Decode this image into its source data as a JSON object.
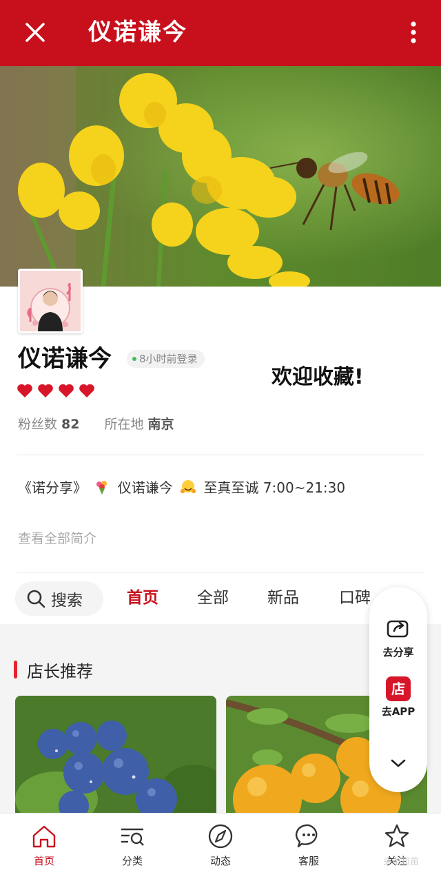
{
  "topbar": {
    "title": "仪诺谦今",
    "bg_color": "#c8101c"
  },
  "shop": {
    "name": "仪诺谦今",
    "login_status": "8小时前登录",
    "welcome": "欢迎收藏!",
    "rating_hearts": 4,
    "fans_label": "粉丝数",
    "fans_count": "82",
    "location_label": "所在地",
    "location": "南京",
    "intro_part1": "《诺分享》",
    "intro_part2": "仪诺谦今",
    "intro_part3": "至真至诚 7:00~21:30",
    "view_all": "查看全部简介"
  },
  "nav": {
    "search_label": "搜索",
    "tabs": [
      "首页",
      "全部",
      "新品",
      "口碑"
    ],
    "active_tab": "首页"
  },
  "section": {
    "title": "店长推荐",
    "accent_color": "#e5242b"
  },
  "float_panel": {
    "share_label": "去分享",
    "app_label": "去APP",
    "app_badge": "店"
  },
  "bottom_nav": {
    "items": [
      {
        "label": "首页",
        "icon": "home-icon",
        "active": true
      },
      {
        "label": "分类",
        "icon": "category-search-icon",
        "active": false
      },
      {
        "label": "动态",
        "icon": "compass-icon",
        "active": false
      },
      {
        "label": "客服",
        "icon": "chat-icon",
        "active": false
      },
      {
        "label": "关注",
        "icon": "star-icon",
        "active": false
      }
    ]
  },
  "watermark": "头条和苗"
}
